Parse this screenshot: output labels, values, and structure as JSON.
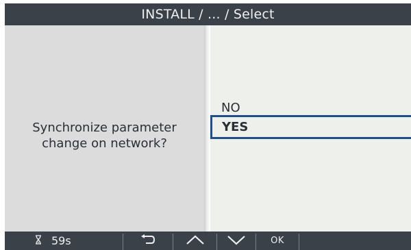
{
  "header": {
    "title": "INSTALL / ... / Select"
  },
  "prompt": {
    "line1": "Synchronize parameter",
    "line2": "change on network?"
  },
  "options": [
    {
      "label": "NO",
      "selected": false
    },
    {
      "label": "YES",
      "selected": true
    }
  ],
  "footer": {
    "timer_icon": "hourglass-icon",
    "timer_value": "59s",
    "back_icon": "back-arrow-icon",
    "up_icon": "chevron-up-icon",
    "down_icon": "chevron-down-icon",
    "ok_label": "OK"
  },
  "colors": {
    "title_bar": "#3a4149",
    "left_panel": "#dcdcdc",
    "right_panel": "#eef0ec",
    "selection_border": "#1f4f8a"
  }
}
